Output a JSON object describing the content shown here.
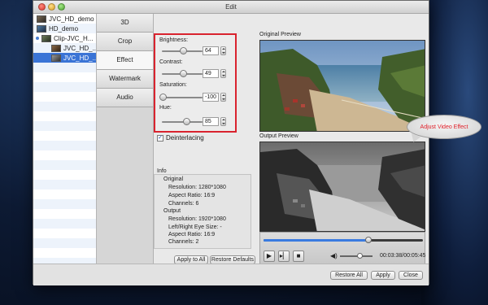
{
  "window": {
    "title": "Edit"
  },
  "file_list": {
    "items": [
      {
        "label": "JVC_HD_demo",
        "indent": 1,
        "selected": false
      },
      {
        "label": "HD_demo",
        "indent": 1,
        "selected": false
      },
      {
        "label": "Clip-JVC_H...",
        "indent": 1,
        "selected": false,
        "dot": true
      },
      {
        "label": "JVC_HD_...",
        "indent": 2,
        "selected": false
      },
      {
        "label": "JVC_HD_...",
        "indent": 2,
        "selected": true
      }
    ]
  },
  "tabs": [
    "3D",
    "Crop",
    "Effect",
    "Watermark",
    "Audio"
  ],
  "active_tab": "Effect",
  "effect": {
    "brightness_label": "Brightness:",
    "brightness_value": "64",
    "contrast_label": "Contrast:",
    "contrast_value": "49",
    "saturation_label": "Saturation:",
    "saturation_value": "-100",
    "hue_label": "Hue:",
    "hue_value": "85",
    "deinterlacing_label": "Deinterlacing",
    "deinterlacing_checked": true
  },
  "info": {
    "title": "Info",
    "original_label": "Original",
    "original_resolution": "Resolution: 1280*1080",
    "original_aspect": "Aspect Ratio: 16:9",
    "original_channels": "Channels: 6",
    "output_label": "Output",
    "output_resolution": "Resolution: 1920*1080",
    "output_eye": "Left/Right Eye Size: -",
    "output_aspect": "Aspect Ratio: 16:9",
    "output_channels": "Channels: 2"
  },
  "buttons": {
    "apply_to_all": "Apply to All",
    "restore_defaults": "Restore Defaults",
    "restore_all": "Restore All",
    "apply": "Apply",
    "close": "Close"
  },
  "preview": {
    "original_label": "Original Preview",
    "output_label": "Output Preview",
    "timecode": "00:03:38/00:05:45",
    "progress_fraction": 0.66,
    "volume_fraction": 0.6
  },
  "callout": {
    "text": "Adjust Video Effect",
    "color": "#e0202a"
  },
  "colors": {
    "highlight_border": "#d9232e",
    "selection": "#3a74d6"
  }
}
